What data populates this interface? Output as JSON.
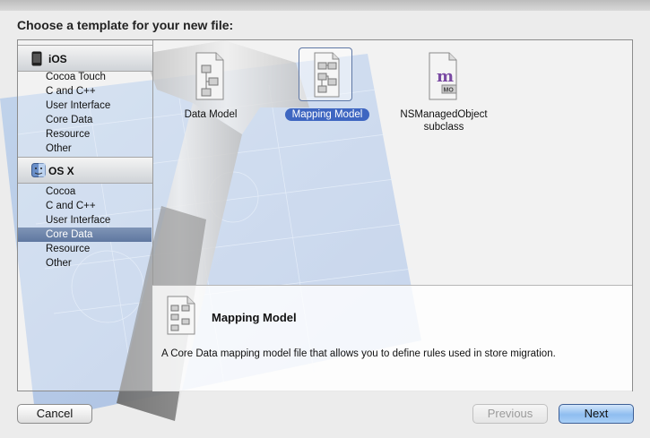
{
  "dialog": {
    "title": "Choose a template for your new file:"
  },
  "sidebar": {
    "sections": [
      {
        "label": "iOS",
        "icon": "iphone-icon",
        "items": [
          "Cocoa Touch",
          "C and C++",
          "User Interface",
          "Core Data",
          "Resource",
          "Other"
        ]
      },
      {
        "label": "OS X",
        "icon": "mac-finder-icon",
        "items": [
          "Cocoa",
          "C and C++",
          "User Interface",
          "Core Data",
          "Resource",
          "Other"
        ]
      }
    ],
    "selected": "OS X / Core Data"
  },
  "templates": [
    {
      "name": "Data Model",
      "icon": "data-model-file-icon",
      "selected": false
    },
    {
      "name": "Mapping Model",
      "icon": "mapping-model-file-icon",
      "selected": true
    },
    {
      "name_line1": "NSManagedObject",
      "name_line2": "subclass",
      "icon": "managed-object-file-icon",
      "badge": "MO",
      "letter": "m",
      "selected": false
    }
  ],
  "description": {
    "title": "Mapping Model",
    "text": "A Core Data mapping model file that allows you to define rules used in store migration."
  },
  "buttons": {
    "cancel": "Cancel",
    "previous": "Previous",
    "next": "Next"
  },
  "colors": {
    "selection": "#3e66c1",
    "sidebar_selection": "#6b82ab",
    "default_button": "#8fbdf0"
  }
}
